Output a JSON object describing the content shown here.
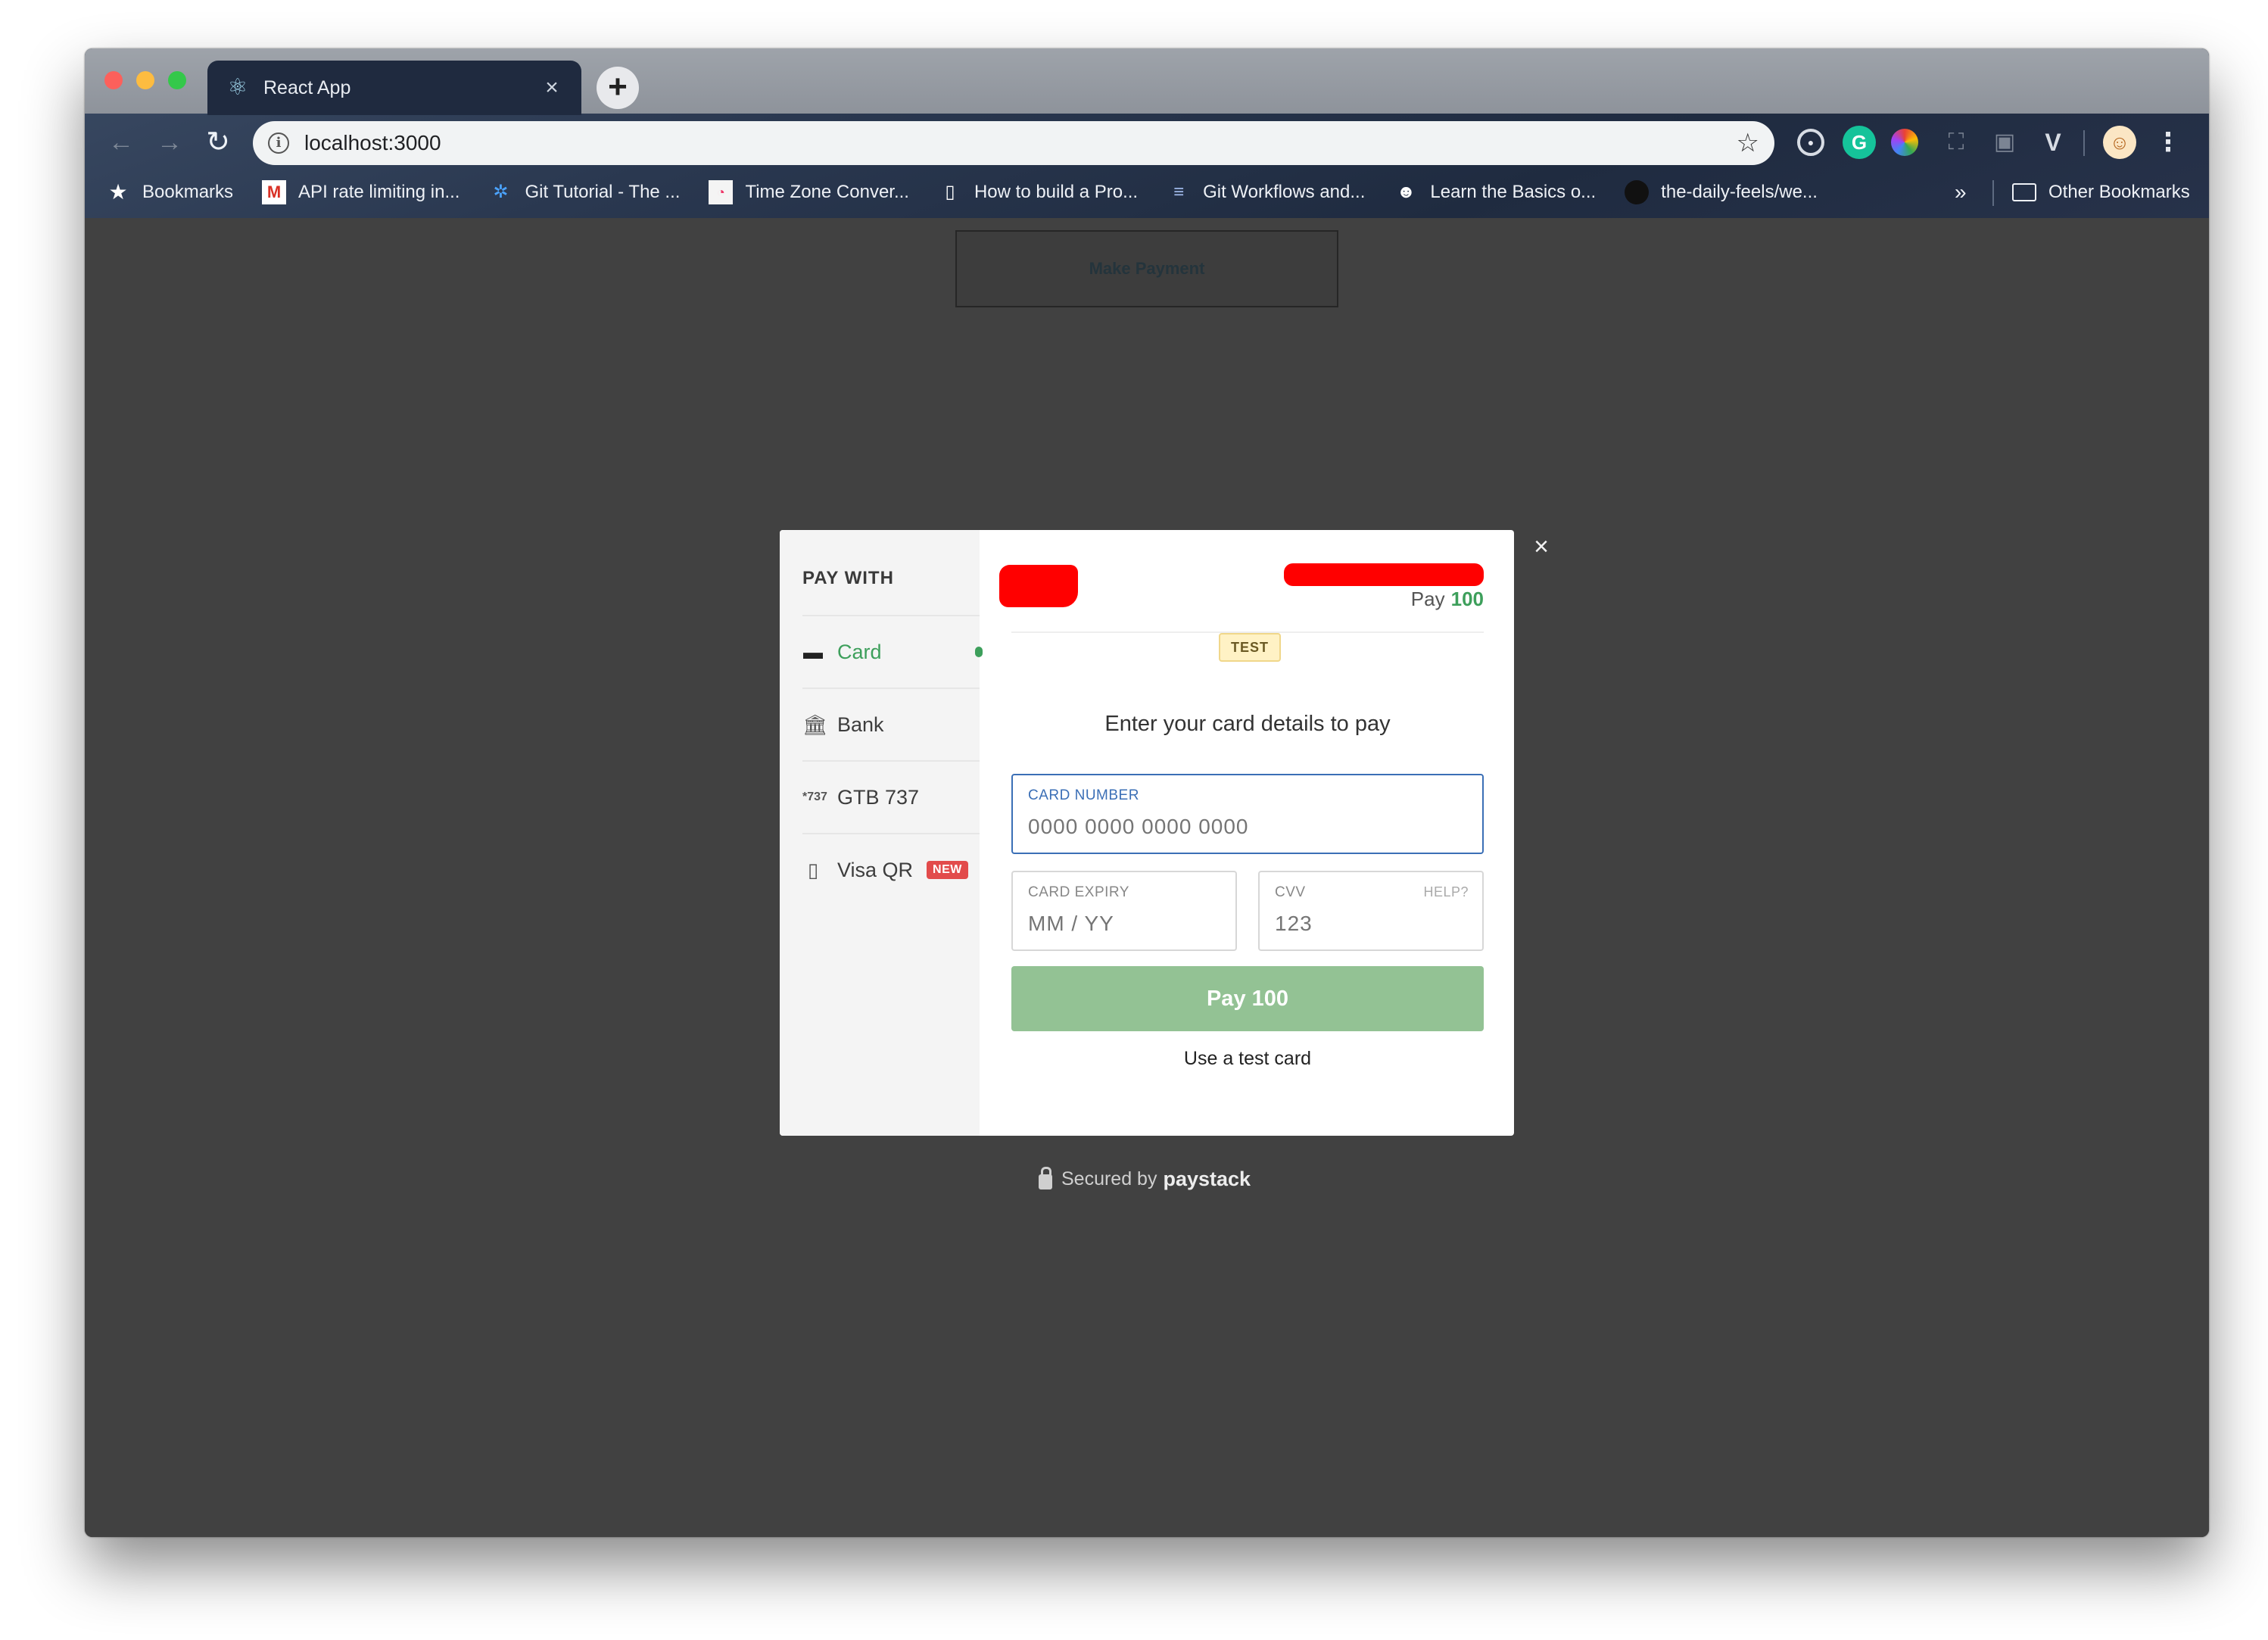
{
  "browser": {
    "tab_title": "React App",
    "url": "localhost:3000",
    "bookmarks": [
      {
        "label": "Bookmarks",
        "icon": "star-icon"
      },
      {
        "label": "API rate limiting in...",
        "icon": "gmail-icon"
      },
      {
        "label": "Git Tutorial - The ...",
        "icon": "git-icon"
      },
      {
        "label": "Time Zone Conver...",
        "icon": "timezone-icon"
      },
      {
        "label": "How to build a Pro...",
        "icon": "document-icon"
      },
      {
        "label": "Git Workflows and...",
        "icon": "database-icon"
      },
      {
        "label": "Learn the Basics o...",
        "icon": "ninja-icon"
      },
      {
        "label": "the-daily-feels/we...",
        "icon": "github-icon"
      }
    ],
    "bookmarks_more": "»",
    "other_bookmarks": "Other Bookmarks"
  },
  "page": {
    "make_payment_label": "Make Payment"
  },
  "modal": {
    "pay_with": "PAY WITH",
    "methods": [
      {
        "label": "Card",
        "active": true,
        "icon": "card-icon"
      },
      {
        "label": "Bank",
        "active": false,
        "icon": "bank-icon"
      },
      {
        "label": "GTB 737",
        "active": false,
        "icon": "ussd-icon",
        "icon_text": "*737"
      },
      {
        "label": "Visa QR",
        "active": false,
        "icon": "qr-phone-icon",
        "badge": "NEW"
      }
    ],
    "pay_label": "Pay",
    "amount": "100",
    "test_badge": "TEST",
    "instruction": "Enter your card details to pay",
    "card_number": {
      "label": "CARD NUMBER",
      "placeholder": "0000 0000 0000 0000"
    },
    "card_expiry": {
      "label": "CARD EXPIRY",
      "placeholder": "MM / YY"
    },
    "cvv": {
      "label": "CVV",
      "help": "HELP?",
      "placeholder": "123"
    },
    "pay_button": "Pay 100",
    "test_card_link": "Use a test card",
    "close_symbol": "×"
  },
  "footer": {
    "secured_by": "Secured by",
    "brand": "paystack"
  },
  "colors": {
    "accent_green": "#3d9f5b",
    "pay_button": "#93c294",
    "focus_blue": "#3b6fb6",
    "new_badge": "#e24b4b"
  }
}
